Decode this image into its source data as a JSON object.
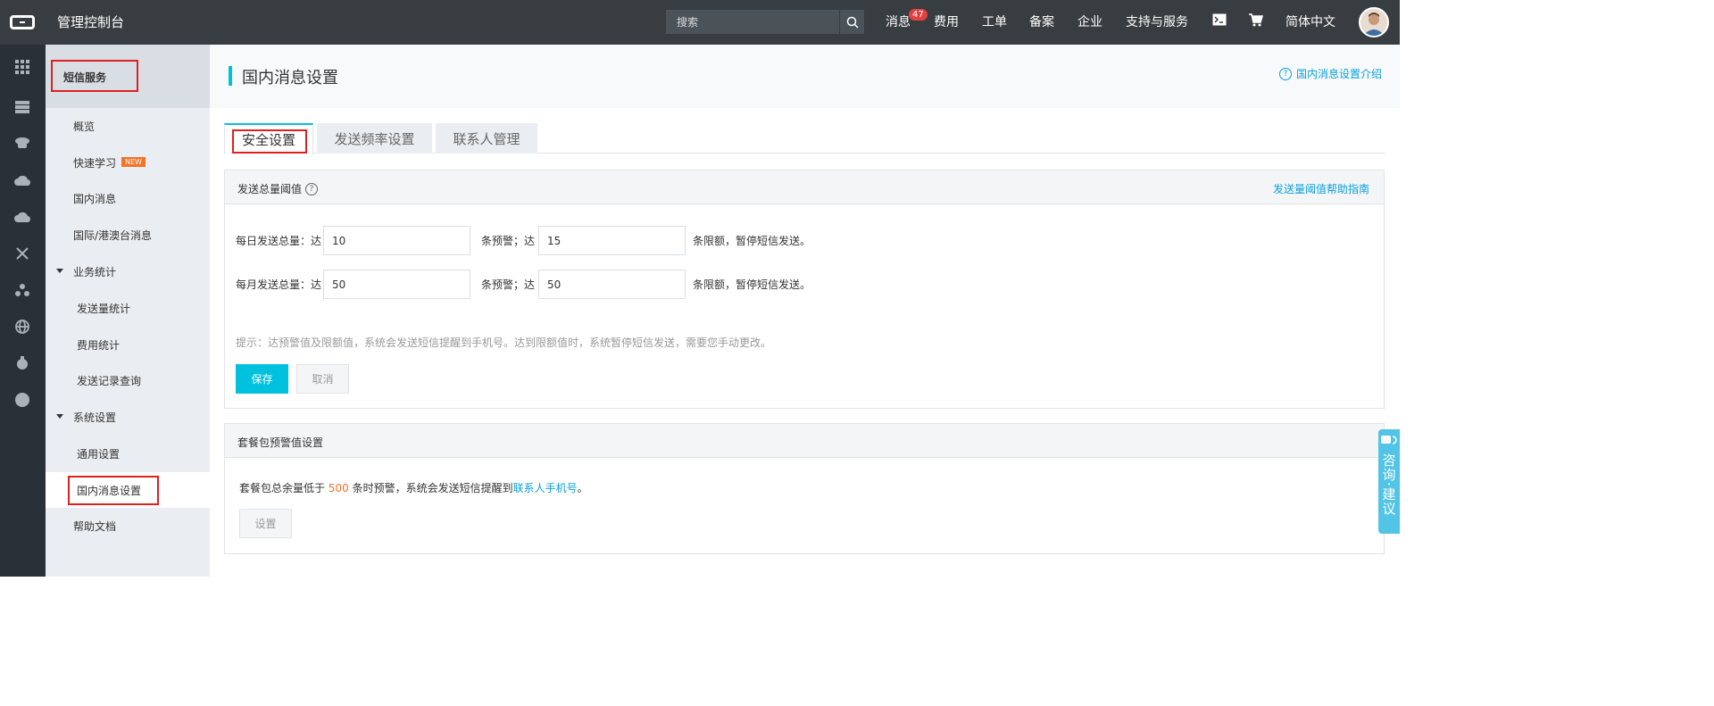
{
  "topbar": {
    "title": "管理控制台",
    "search_placeholder": "搜索",
    "nav": {
      "messages": "消息",
      "messages_badge": "47",
      "billing": "费用",
      "tickets": "工单",
      "icp": "备案",
      "enterprise": "企业",
      "support": "支持与服务",
      "language": "简体中文"
    }
  },
  "sidebar": {
    "header": "短信服务",
    "items": [
      {
        "label": "概览"
      },
      {
        "label": "快速学习",
        "badge": "NEW"
      },
      {
        "label": "国内消息"
      },
      {
        "label": "国际/港澳台消息"
      },
      {
        "label": "业务统计"
      },
      {
        "label": "发送量统计"
      },
      {
        "label": "费用统计"
      },
      {
        "label": "发送记录查询"
      },
      {
        "label": "系统设置"
      },
      {
        "label": "通用设置"
      },
      {
        "label": "国内消息设置"
      },
      {
        "label": "帮助文档"
      }
    ]
  },
  "page": {
    "title": "国内消息设置",
    "help_link": "国内消息设置介绍",
    "tabs": [
      {
        "label": "安全设置"
      },
      {
        "label": "发送频率设置"
      },
      {
        "label": "联系人管理"
      }
    ]
  },
  "threshold_panel": {
    "title": "发送总量阈值",
    "help_link": "发送量阈值帮助指南",
    "daily": {
      "label": "每日发送总量：达",
      "warn_value": "10",
      "mid_label": "条预警；达",
      "limit_value": "15",
      "end_label": "条限额，暂停短信发送。"
    },
    "monthly": {
      "label": "每月发送总量：达",
      "warn_value": "50",
      "mid_label": "条预警；达",
      "limit_value": "50",
      "end_label": "条限额，暂停短信发送。"
    },
    "tip": "提示：达预警值及限额值，系统会发送短信提醒到手机号。达到限额值时，系统暂停短信发送，需要您手动更改。",
    "save": "保存",
    "cancel": "取消"
  },
  "package_panel": {
    "title": "套餐包预警值设置",
    "text_before": "套餐包总余量低于",
    "value": "500",
    "text_middle": "条时预警，系统会发送短信提醒到",
    "link": "联系人手机号",
    "text_end": "。",
    "set_button": "设置"
  },
  "consult": {
    "label": "咨询·建议"
  },
  "colors": {
    "topbar": "#373d41",
    "rail": "#293038",
    "accent": "#00c1de",
    "link": "#0aa1d8",
    "warning": "#f37327",
    "highlight_box": "#e02020"
  }
}
